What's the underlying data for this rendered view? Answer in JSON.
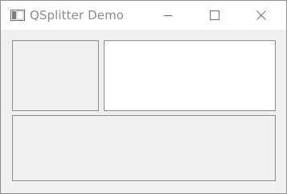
{
  "window": {
    "title": "QSplitter Demo",
    "app_icon": "window-app-icon"
  },
  "caption_buttons": {
    "minimize_icon": "minimize-icon",
    "maximize_icon": "maximize-icon",
    "close_icon": "close-icon"
  },
  "colors": {
    "title_text": "#8a8a8a",
    "window_background": "#f0f0f0",
    "pane_white": "#ffffff",
    "pane_border": "#8c8c8c"
  }
}
